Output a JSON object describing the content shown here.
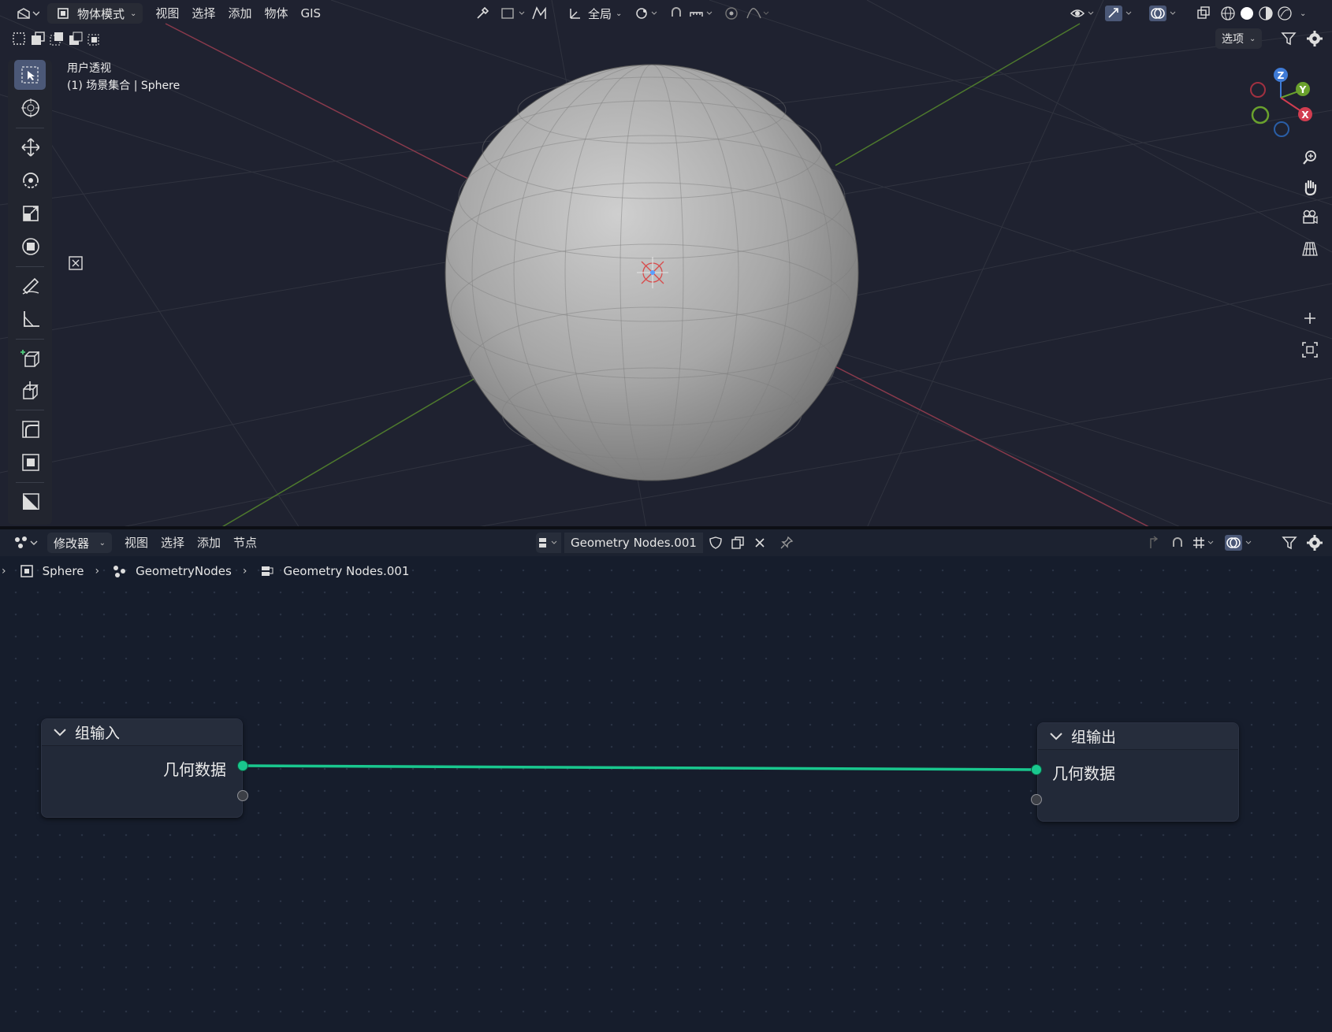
{
  "viewport": {
    "header": {
      "mode_label": "物体模式",
      "menus": [
        "视图",
        "选择",
        "添加",
        "物体",
        "GIS"
      ],
      "transform_orientation": "全局"
    },
    "options_label": "选项",
    "view_name": "用户透视",
    "object_info": "(1) 场景集合 | Sphere",
    "gizmo": {
      "z": "Z",
      "y": "Y",
      "x": "X"
    }
  },
  "node_editor": {
    "header": {
      "editor_type_label": "修改器",
      "menus": [
        "视图",
        "选择",
        "添加",
        "节点"
      ],
      "node_group_name": "Geometry Nodes.001"
    },
    "breadcrumb": [
      "Sphere",
      "GeometryNodes",
      "Geometry Nodes.001"
    ],
    "nodes": {
      "group_input": {
        "title": "组输入",
        "socket_label": "几何数据"
      },
      "group_output": {
        "title": "组输出",
        "socket_label": "几何数据"
      }
    },
    "colors": {
      "geometry_socket": "#19c78e",
      "link": "#19c78e"
    }
  }
}
